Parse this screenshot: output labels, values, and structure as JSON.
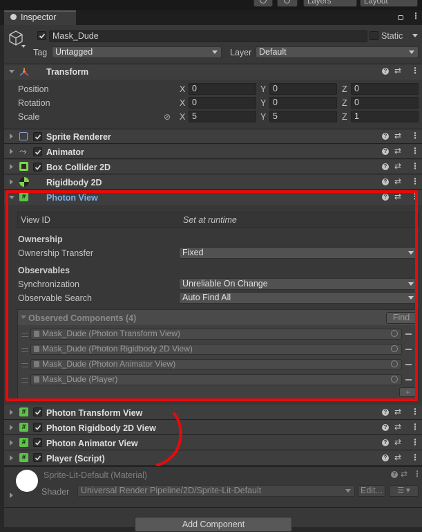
{
  "top": {
    "layers": "Layers",
    "layout": "Layout"
  },
  "tab": {
    "title": "Inspector"
  },
  "object": {
    "name": "Mask_Dude",
    "static_label": "Static",
    "tag_label": "Tag",
    "tag_value": "Untagged",
    "layer_label": "Layer",
    "layer_value": "Default"
  },
  "transform": {
    "title": "Transform",
    "rows": [
      {
        "label": "Position",
        "x": "0",
        "y": "0",
        "z": "0"
      },
      {
        "label": "Rotation",
        "x": "0",
        "y": "0",
        "z": "0"
      },
      {
        "label": "Scale",
        "x": "5",
        "y": "5",
        "z": "1"
      }
    ],
    "axis": {
      "x": "X",
      "y": "Y",
      "z": "Z"
    }
  },
  "components_top": [
    "Sprite Renderer",
    "Animator",
    "Box Collider 2D",
    "Rigidbody 2D"
  ],
  "photon": {
    "title": "Photon View",
    "view_id_label": "View ID",
    "view_id_value": "Set at runtime",
    "ownership_header": "Ownership",
    "ownership_transfer_label": "Ownership Transfer",
    "ownership_transfer_value": "Fixed",
    "observables_header": "Observables",
    "sync_label": "Synchronization",
    "sync_value": "Unreliable On Change",
    "search_label": "Observable Search",
    "search_value": "Auto Find All",
    "observed_header": "Observed Components (4)",
    "find_button": "Find",
    "observed": [
      "Mask_Dude (Photon Transform View)",
      "Mask_Dude (Photon Rigidbody 2D View)",
      "Mask_Dude (Photon Animator View)",
      "Mask_Dude (Player)"
    ],
    "add_symbol": "+"
  },
  "components_bottom": [
    "Photon Transform View",
    "Photon Rigidbody 2D View",
    "Photon Animator View",
    "Player (Script)"
  ],
  "material": {
    "name": "Sprite-Lit-Default (Material)",
    "shader_label": "Shader",
    "shader_value": "Universal Render Pipeline/2D/Sprite-Lit-Default",
    "edit_button": "Edit..."
  },
  "add_component": "Add Component",
  "colors": {
    "highlight": "#e60b0b",
    "link": "#7ab0f0",
    "photon_icon": "#5ec24a",
    "transform_icon": "#e8a040"
  }
}
